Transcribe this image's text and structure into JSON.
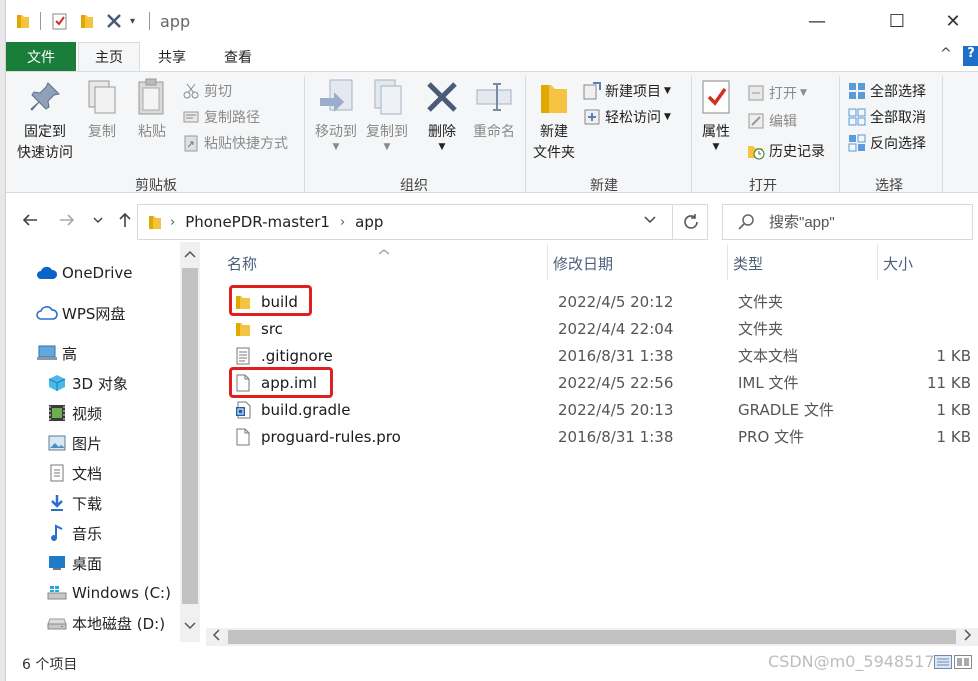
{
  "window": {
    "title": "app",
    "controls": {
      "minimize": "—",
      "maximize": "☐",
      "close": "✕"
    }
  },
  "tabs": {
    "file": "文件",
    "home": "主页",
    "share": "共享",
    "view": "查看",
    "collapse": "^",
    "help": "?"
  },
  "ribbon": {
    "clipboard": {
      "label": "剪贴板",
      "pin_line1": "固定到",
      "pin_line2": "快速访问",
      "copy": "复制",
      "paste": "粘贴",
      "cut": "剪切",
      "copy_path": "复制路径",
      "paste_shortcut": "粘贴快捷方式"
    },
    "organize": {
      "label": "组织",
      "move_to": "移动到",
      "copy_to": "复制到",
      "delete": "删除",
      "rename": "重命名"
    },
    "new": {
      "label": "新建",
      "new_folder_line1": "新建",
      "new_folder_line2": "文件夹",
      "new_item": "新建项目",
      "easy_access": "轻松访问"
    },
    "open": {
      "label": "打开",
      "properties": "属性",
      "open": "打开",
      "edit": "编辑",
      "history": "历史记录"
    },
    "select": {
      "label": "选择",
      "select_all": "全部选择",
      "select_none": "全部取消",
      "invert": "反向选择"
    }
  },
  "address": {
    "segments": [
      "PhonePDR-master1",
      "app"
    ],
    "search_placeholder": "搜索\"app\""
  },
  "nav": {
    "items": [
      {
        "label": "OneDrive",
        "icon": "cloud-icon"
      },
      {
        "label": "WPS网盘",
        "icon": "wps-cloud-icon"
      },
      {
        "label": "高",
        "icon": "computer-icon"
      },
      {
        "label": "3D 对象",
        "icon": "3d-objects-icon"
      },
      {
        "label": "视频",
        "icon": "video-icon"
      },
      {
        "label": "图片",
        "icon": "pictures-icon"
      },
      {
        "label": "文档",
        "icon": "documents-icon"
      },
      {
        "label": "下载",
        "icon": "download-icon"
      },
      {
        "label": "音乐",
        "icon": "music-icon"
      },
      {
        "label": "桌面",
        "icon": "desktop-icon"
      },
      {
        "label": "Windows (C:)",
        "icon": "windows-drive-icon"
      },
      {
        "label": "本地磁盘 (D:)",
        "icon": "drive-icon"
      }
    ]
  },
  "columns": {
    "name": "名称",
    "date": "修改日期",
    "type": "类型",
    "size": "大小"
  },
  "files": [
    {
      "name": "build",
      "date": "2022/4/5 20:12",
      "type": "文件夹",
      "size": "",
      "icon": "folder-icon"
    },
    {
      "name": "src",
      "date": "2022/4/4 22:04",
      "type": "文件夹",
      "size": "",
      "icon": "folder-icon"
    },
    {
      "name": ".gitignore",
      "date": "2016/8/31 1:38",
      "type": "文本文档",
      "size": "1 KB",
      "icon": "text-file-icon"
    },
    {
      "name": "app.iml",
      "date": "2022/4/5 22:56",
      "type": "IML 文件",
      "size": "11 KB",
      "icon": "file-icon"
    },
    {
      "name": "build.gradle",
      "date": "2022/4/5 20:13",
      "type": "GRADLE 文件",
      "size": "1 KB",
      "icon": "gradle-file-icon"
    },
    {
      "name": "proguard-rules.pro",
      "date": "2016/8/31 1:38",
      "type": "PRO 文件",
      "size": "1 KB",
      "icon": "file-icon"
    }
  ],
  "status": {
    "item_count": "6 个项目"
  },
  "watermark": "CSDN@m0_59485170",
  "colors": {
    "file_tab": "#1a7d3a",
    "highlight": "#e02020",
    "folder": "#f5c342"
  }
}
